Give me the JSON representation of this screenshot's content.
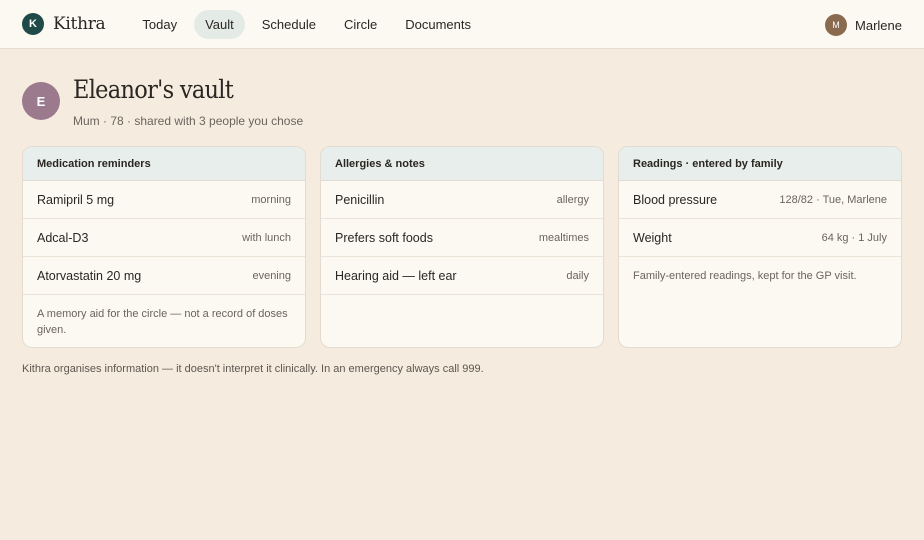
{
  "app": {
    "logo_letter": "K",
    "name": "Kithra"
  },
  "nav": [
    {
      "label": "Today"
    },
    {
      "label": "Vault",
      "active": true
    },
    {
      "label": "Schedule"
    },
    {
      "label": "Circle"
    },
    {
      "label": "Documents"
    }
  ],
  "user": {
    "initial": "M",
    "name": "Marlene"
  },
  "vault": {
    "initial": "E",
    "title": "Eleanor's vault",
    "subtitle": "Mum · 78 · shared with 3 people you chose"
  },
  "cards": [
    {
      "title": "Medication reminders",
      "rows": [
        {
          "label": "Ramipril 5 mg",
          "value": "morning"
        },
        {
          "label": "Adcal-D3",
          "value": "with lunch"
        },
        {
          "label": "Atorvastatin 20 mg",
          "value": "evening"
        }
      ],
      "note": "A memory aid for the circle — not a record of doses given."
    },
    {
      "title": "Allergies & notes",
      "rows": [
        {
          "label": "Penicillin",
          "value": "allergy"
        },
        {
          "label": "Prefers soft foods",
          "value": "mealtimes"
        },
        {
          "label": "Hearing aid — left ear",
          "value": "daily"
        }
      ]
    },
    {
      "title": "Readings · entered by family",
      "rows": [
        {
          "label": "Blood pressure",
          "value": "128/82 · Tue, Marlene"
        },
        {
          "label": "Weight",
          "value": "64 kg · 1 July"
        }
      ],
      "note": "Family-entered readings, kept for the GP visit."
    }
  ],
  "footer": "Kithra organises information — it doesn't interpret it clinically. In an emergency always call 999.",
  "colors": {
    "accent": "#1f4a48",
    "background": "#f5ecdf",
    "card_header": "#e8eeeb"
  }
}
